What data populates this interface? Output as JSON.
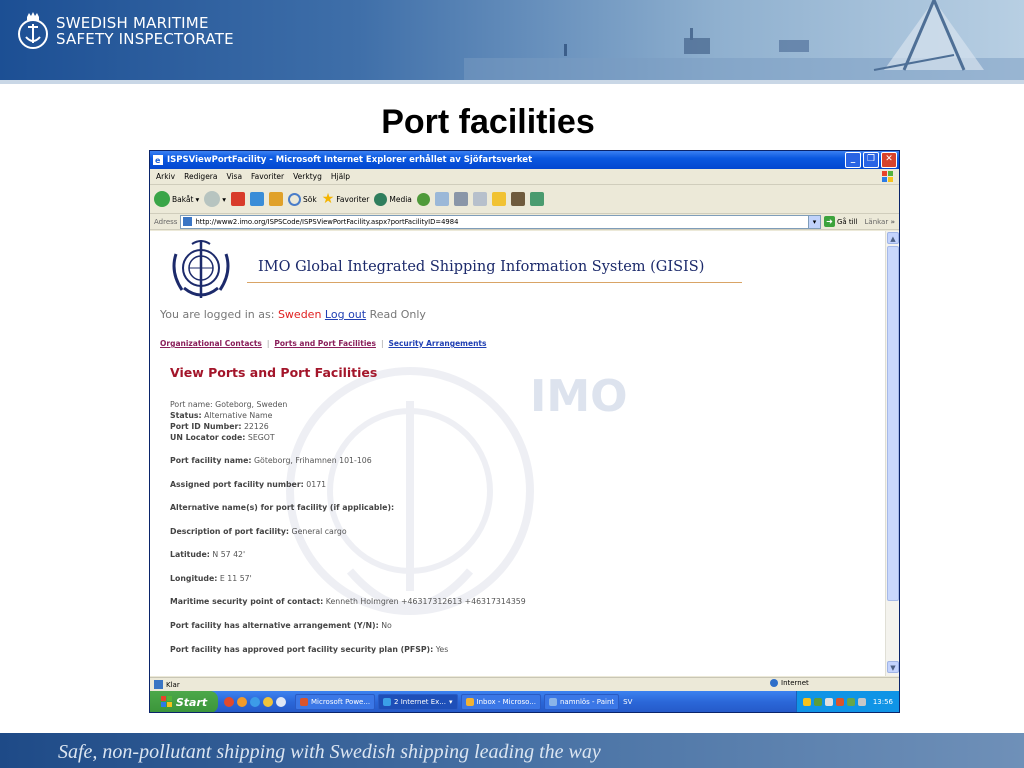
{
  "slide": {
    "logo_line1": "SWEDISH MARITIME",
    "logo_line2": "SAFETY INSPECTORATE",
    "title": "Port facilities",
    "footer": "Safe, non-pollutant shipping with Swedish shipping leading the way"
  },
  "browser": {
    "window_title": "ISPSViewPortFacility - Microsoft Internet Explorer erhållet av Sjöfartsverket",
    "menu": [
      "Arkiv",
      "Redigera",
      "Visa",
      "Favoriter",
      "Verktyg",
      "Hjälp"
    ],
    "toolbar": {
      "back": "Bakåt",
      "search": "Sök",
      "favorites": "Favoriter",
      "media": "Media"
    },
    "address_label": "Adress",
    "address_url": "http://www2.imo.org/ISPSCode/ISPSViewPortFacility.aspx?portFacilityID=4984",
    "go_label": "Gå till",
    "links_label": "Länkar",
    "status_left": "Klar",
    "status_zone": "Internet"
  },
  "page": {
    "gisis_title": "IMO Global Integrated Shipping Information System (GISIS)",
    "watermark_text": "IMO",
    "logged_prefix": "You are logged in as:",
    "logged_country": "Sweden",
    "logout_label": "Log out",
    "read_only": "Read Only",
    "nav": [
      "Organizational Contacts",
      "Ports and Port Facilities",
      "Security Arrangements"
    ],
    "heading": "View Ports and Port Facilities",
    "port_name": "Port name: Goteborg, Sweden",
    "status_label": "Status:",
    "status_value": "Alternative Name",
    "port_id_label": "Port ID Number:",
    "port_id_value": "22126",
    "un_label": "UN Locator code:",
    "un_value": "SEGOT",
    "facility_name_label": "Port facility name:",
    "facility_name_value": "Göteborg, Frihamnen 101-106",
    "assigned_label": "Assigned port facility number:",
    "assigned_value": "0171",
    "altname_label": "Alternative name(s) for port facility (if applicable):",
    "desc_label": "Description of port facility:",
    "desc_value": "General cargo",
    "lat_label": "Latitude:",
    "lat_value": "N 57 42'",
    "lon_label": "Longitude:",
    "lon_value": "E 11 57'",
    "contact_label": "Maritime security point of contact:",
    "contact_value": "Kenneth Holmgren +46317312613 +46317314359",
    "altarr_label": "Port facility has alternative arrangement (Y/N):",
    "altarr_value": "No",
    "pfsp_label": "Port facility has approved port facility security plan (PFSP):",
    "pfsp_value": "Yes"
  },
  "taskbar": {
    "start": "Start",
    "tasks": [
      "Microsoft Powe...",
      "2 Internet Ex...",
      "Inbox - Microso...",
      "namnlös - Paint"
    ],
    "lang": "SV",
    "clock": "13:56"
  }
}
